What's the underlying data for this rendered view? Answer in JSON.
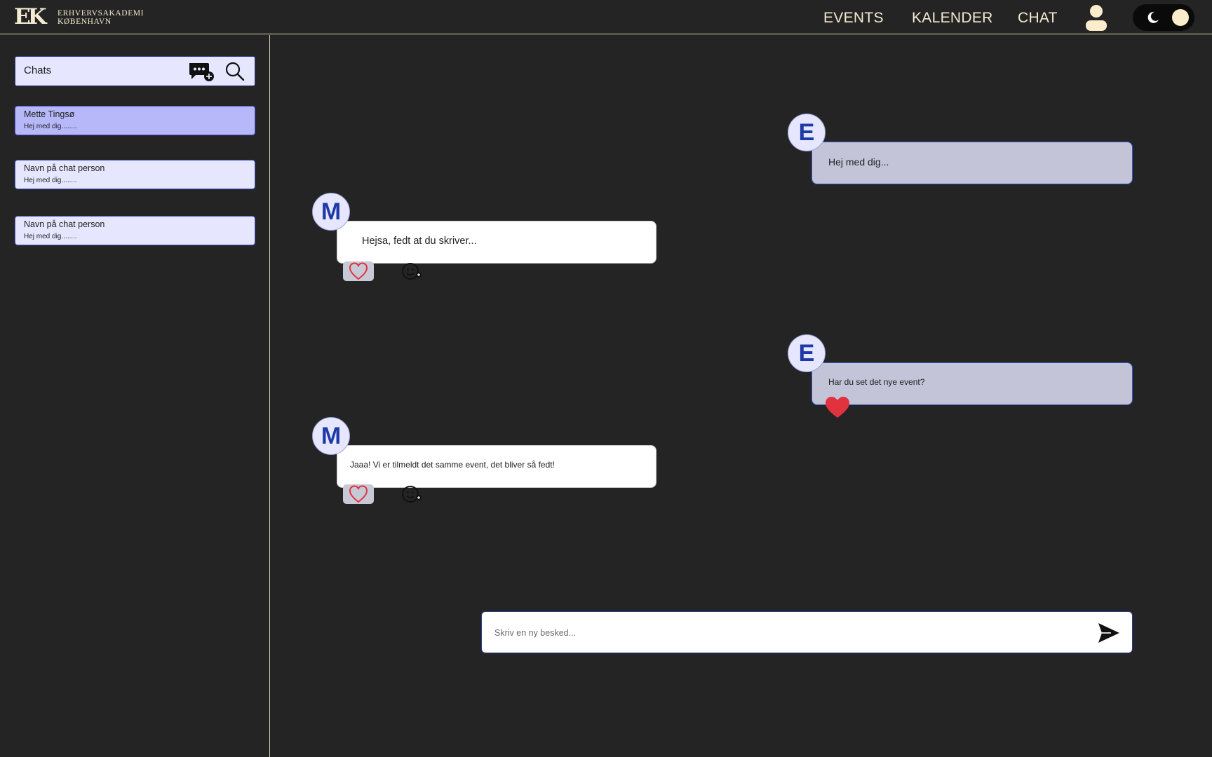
{
  "header": {
    "logo_mark": "EK",
    "logo_line1": "ERHVERVSAKADEMI",
    "logo_line2": "KØBENHAVN",
    "nav": [
      "EVENTS",
      "KALENDER",
      "CHAT"
    ],
    "profile_icon": "user-icon",
    "theme_toggle_icons": [
      "moon-icon",
      "sun-icon"
    ]
  },
  "sidebar": {
    "search_label": "Chats",
    "new_chat_icon": "new-chat-icon",
    "search_icon": "search-icon",
    "chats": [
      {
        "name": "Mette Tingsø",
        "preview": "Hej med dig........",
        "active": true
      },
      {
        "name": "Navn på chat person",
        "preview": "Hej med dig........",
        "active": false
      },
      {
        "name": "Navn på chat person",
        "preview": "Hej med dig........",
        "active": false
      }
    ]
  },
  "conversation": {
    "messages": [
      {
        "from": "E",
        "direction": "outgoing",
        "text": "Hej med dig..."
      },
      {
        "from": "M",
        "direction": "incoming",
        "text": "Hejsa, fedt at du skriver..."
      },
      {
        "from": "E",
        "direction": "outgoing",
        "text": "Har du set det nye event?"
      },
      {
        "from": "M",
        "direction": "incoming",
        "text": "Jaaa! Vi er tilmeldt det samme event, det bliver så fedt!"
      }
    ]
  },
  "composer": {
    "placeholder": "Skriv en ny besked...",
    "send_icon": "send-icon"
  },
  "colors": {
    "background": "#242424",
    "header_text": "#f3ead0",
    "chat_item_bg": "#e6e7ff",
    "chat_item_active_bg": "#b6b8f9",
    "outgoing_bubble": "#c3c4d8",
    "incoming_bubble": "#ffffff",
    "avatar_letter": "#1e3aa6",
    "heart": "#e0333f"
  }
}
